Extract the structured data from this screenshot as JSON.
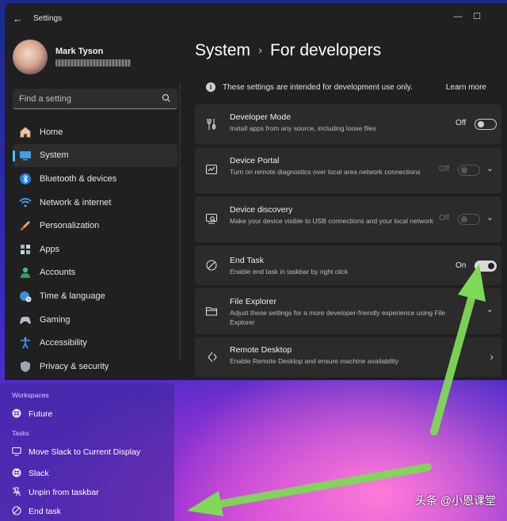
{
  "window": {
    "title": "Settings",
    "back_icon": "back-arrow-icon",
    "controls": [
      "minimize-icon",
      "maximize-icon",
      "close-icon"
    ]
  },
  "profile": {
    "name": "Mark Tyson"
  },
  "search": {
    "placeholder": "Find a setting"
  },
  "sidebar": {
    "items": [
      {
        "label": "Home",
        "icon": "home-icon",
        "active": false
      },
      {
        "label": "System",
        "icon": "system-icon",
        "active": true
      },
      {
        "label": "Bluetooth & devices",
        "icon": "bluetooth-icon",
        "active": false
      },
      {
        "label": "Network & internet",
        "icon": "wifi-icon",
        "active": false
      },
      {
        "label": "Personalization",
        "icon": "brush-icon",
        "active": false
      },
      {
        "label": "Apps",
        "icon": "apps-icon",
        "active": false
      },
      {
        "label": "Accounts",
        "icon": "accounts-icon",
        "active": false
      },
      {
        "label": "Time & language",
        "icon": "globe-clock-icon",
        "active": false
      },
      {
        "label": "Gaming",
        "icon": "gaming-icon",
        "active": false
      },
      {
        "label": "Accessibility",
        "icon": "accessibility-icon",
        "active": false
      },
      {
        "label": "Privacy & security",
        "icon": "shield-icon",
        "active": false
      }
    ]
  },
  "main": {
    "breadcrumb_parent": "System",
    "breadcrumb_separator": "›",
    "breadcrumb_current": "For developers",
    "info_text": "These settings are intended for development use only.",
    "learn_more": "Learn more",
    "cards": [
      {
        "title": "Developer Mode",
        "desc": "Install apps from any source, including loose files",
        "toggle_label": "Off",
        "icon": "developer-tools-icon"
      },
      {
        "title": "Device Portal",
        "desc": "Turn on remote diagnostics over local area network connections",
        "toggle_label": "Off",
        "icon": "device-portal-icon"
      },
      {
        "title": "Device discovery",
        "desc": "Make your device visible to USB connections and your local network",
        "toggle_label": "Off",
        "icon": "device-discovery-icon"
      },
      {
        "title": "End Task",
        "desc": "Enable end task in taskbar by right click",
        "toggle_label": "On",
        "icon": "end-task-icon"
      },
      {
        "title": "File Explorer",
        "desc": "Adjust these settings for a more developer-friendly experience using File Explorer",
        "icon": "folder-icon"
      },
      {
        "title": "Remote Desktop",
        "desc": "Enable Remote Desktop and ensure machine availability",
        "icon": "remote-desktop-icon"
      }
    ]
  },
  "jumplist": {
    "workspaces_header": "Workspaces",
    "workspace_item": "Future",
    "tasks_header": "Tasks",
    "items": [
      {
        "label": "Move Slack to Current Display",
        "icon": "display-icon"
      },
      {
        "label": "Slack",
        "icon": "slack-icon"
      },
      {
        "label": "Unpin from taskbar",
        "icon": "unpin-icon"
      },
      {
        "label": "End task",
        "icon": "end-task-icon"
      }
    ]
  },
  "watermark": "头条 @小恩课堂",
  "colors": {
    "accent": "#4cc2ff",
    "arrow": "#7ed957",
    "window_bg": "#202020",
    "card_bg": "#2b2b2b"
  }
}
